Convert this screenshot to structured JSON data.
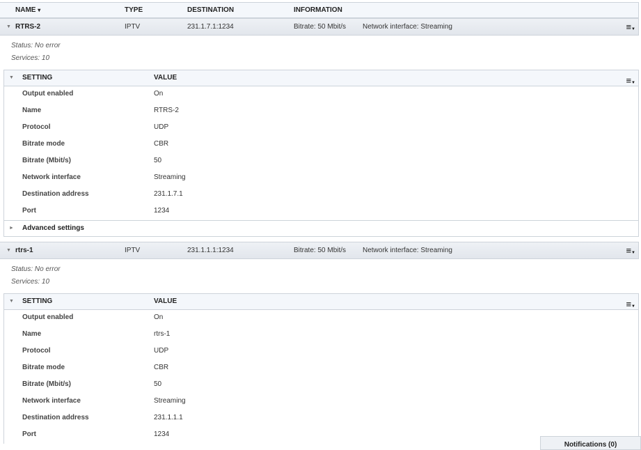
{
  "header": {
    "name": "NAME",
    "sort_icon": "▾",
    "type": "TYPE",
    "destination": "DESTINATION",
    "information": "INFORMATION"
  },
  "outputs": [
    {
      "name": "RTRS-2",
      "type": "IPTV",
      "destination": "231.1.7.1:1234",
      "bitrate_info": "Bitrate: 50 Mbit/s",
      "network_info": "Network interface: Streaming",
      "status": "Status: No error",
      "services": "Services: 10",
      "settings_header": {
        "setting": "SETTING",
        "value": "VALUE"
      },
      "settings": [
        [
          "Output enabled",
          "On"
        ],
        [
          "Name",
          "RTRS-2"
        ],
        [
          "Protocol",
          "UDP"
        ],
        [
          "Bitrate mode",
          "CBR"
        ],
        [
          "Bitrate (Mbit/s)",
          "50"
        ],
        [
          "Network interface",
          "Streaming"
        ],
        [
          "Destination address",
          "231.1.7.1"
        ],
        [
          "Port",
          "1234"
        ]
      ],
      "advanced": "Advanced settings"
    },
    {
      "name": "rtrs-1",
      "type": "IPTV",
      "destination": "231.1.1.1:1234",
      "bitrate_info": "Bitrate: 50 Mbit/s",
      "network_info": "Network interface: Streaming",
      "status": "Status: No error",
      "services": "Services: 10",
      "settings_header": {
        "setting": "SETTING",
        "value": "VALUE"
      },
      "settings": [
        [
          "Output enabled",
          "On"
        ],
        [
          "Name",
          "rtrs-1"
        ],
        [
          "Protocol",
          "UDP"
        ],
        [
          "Bitrate mode",
          "CBR"
        ],
        [
          "Bitrate (Mbit/s)",
          "50"
        ],
        [
          "Network interface",
          "Streaming"
        ],
        [
          "Destination address",
          "231.1.1.1"
        ],
        [
          "Port",
          "1234"
        ]
      ],
      "advanced": null
    }
  ],
  "notifications": "Notifications (0)"
}
